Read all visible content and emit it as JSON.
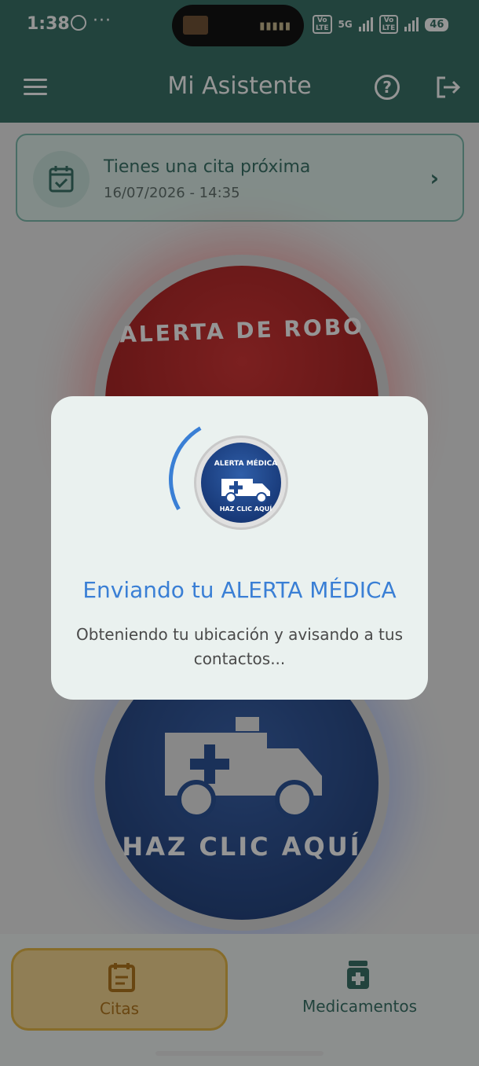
{
  "status_bar": {
    "time": "1:38",
    "dots": "···",
    "network": "5G",
    "battery": "46"
  },
  "app_bar": {
    "title": "Mi Asistente"
  },
  "appointment": {
    "title": "Tienes una cita próxima",
    "datetime": "16/07/2026 - 14:35"
  },
  "buttons": {
    "robbery_label": "ALERTA DE ROBO",
    "medical_label": "HAZ CLIC AQUÍ"
  },
  "dialog": {
    "badge_top": "ALERTA MÉDICA",
    "badge_bottom": "HAZ CLIC AQUÍ",
    "title": "Enviando tu ALERTA MÉDICA",
    "message": "Obteniendo tu ubicación y avisando a tus contactos..."
  },
  "bottom_nav": {
    "items": [
      {
        "label": "Citas",
        "icon": "calendar-icon",
        "selected": true
      },
      {
        "label": "Medicamentos",
        "icon": "medicine-bottle-icon",
        "selected": false
      }
    ]
  },
  "colors": {
    "primary": "#2e6a5f",
    "accent_blue": "#3a7fd5",
    "selected_nav": "#f6d58a"
  }
}
